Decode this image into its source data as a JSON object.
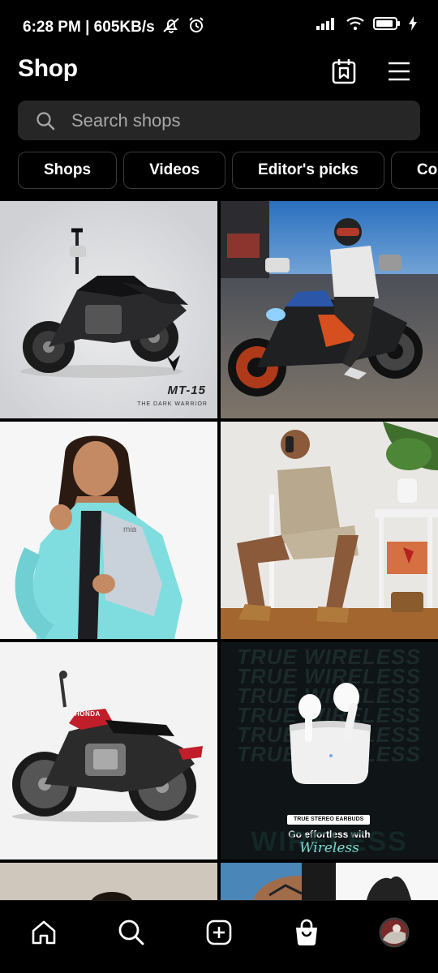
{
  "status_bar": {
    "time_and_speed": "6:28 PM | 605KB/s",
    "icons": [
      "mute-icon",
      "alarm-icon",
      "signal-icon",
      "wifi-icon",
      "battery-icon",
      "charging-icon"
    ]
  },
  "header": {
    "title": "Shop",
    "icons": [
      "wishlist-icon",
      "menu-icon"
    ]
  },
  "search": {
    "placeholder": "Search shops"
  },
  "chips": [
    {
      "label": "Shops"
    },
    {
      "label": "Videos"
    },
    {
      "label": "Editor's picks"
    },
    {
      "label": "Collections"
    }
  ],
  "tiles": {
    "motorcycle_product": {
      "badge": "MT-15",
      "tagline": "THE DARK WARRIOR"
    },
    "rider_photo": {},
    "jacket_model": {
      "brand": "mia"
    },
    "sitting_man": {},
    "red_motorcycle": {
      "brand": "HONDA"
    },
    "earbuds_ad": {
      "bg_text": "TRUE WIRELESS",
      "pill": "TRUE STEREO EARBUDS",
      "headline": "Go effortless with",
      "script": "Wireless",
      "big_word": "WIRELESS"
    },
    "partial_left": {},
    "partial_right": {}
  },
  "bottom_nav": {
    "items": [
      "home-icon",
      "search-icon",
      "create-icon",
      "shop-icon",
      "profile-avatar"
    ]
  },
  "colors": {
    "background": "#000000",
    "search_bg": "#262626",
    "chip_border": "#3a3a3a",
    "placeholder": "#a8a8a8"
  }
}
